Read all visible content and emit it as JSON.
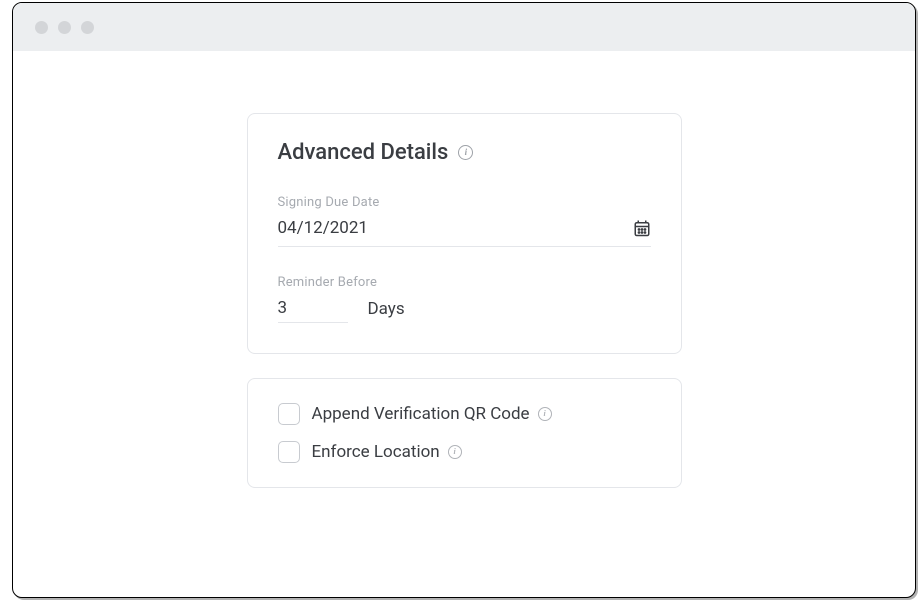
{
  "advanced": {
    "title": "Advanced Details",
    "signing_due_date": {
      "label": "Signing Due Date",
      "value": "04/12/2021"
    },
    "reminder_before": {
      "label": "Reminder Before",
      "value": "3",
      "suffix": "Days"
    }
  },
  "options": {
    "append_qr": {
      "label": "Append Verification QR Code",
      "checked": false
    },
    "enforce_location": {
      "label": "Enforce Location",
      "checked": false
    }
  }
}
